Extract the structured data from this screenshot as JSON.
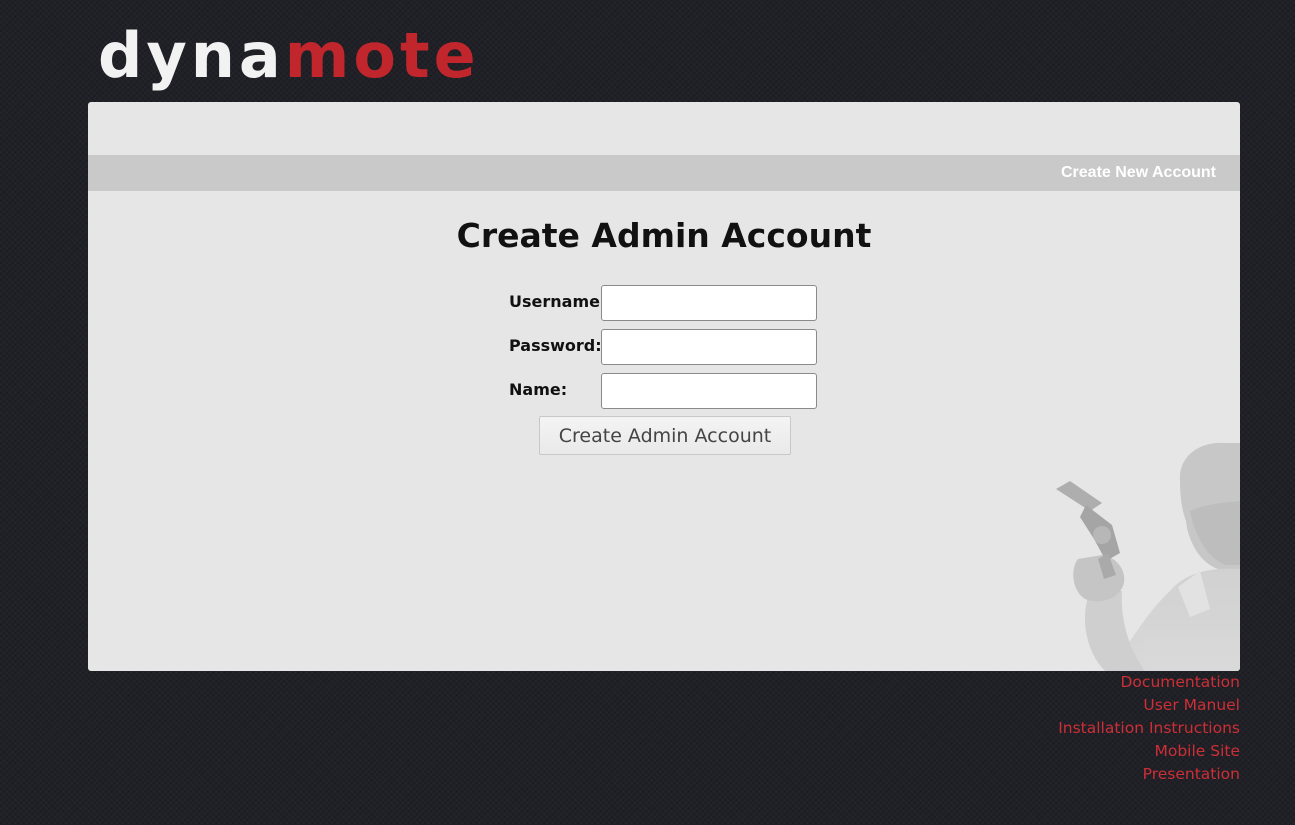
{
  "logo": {
    "part_light": "dyna",
    "part_accent": "mote"
  },
  "nav": {
    "create_account": "Create New Account"
  },
  "form": {
    "title": "Create Admin Account",
    "fields": {
      "username": {
        "label": "Username:",
        "value": ""
      },
      "password": {
        "label": "Password:",
        "value": ""
      },
      "name": {
        "label": "Name:",
        "value": ""
      }
    },
    "submit": "Create Admin Account"
  },
  "footer": {
    "links": [
      "Documentation",
      "User Manuel",
      "Installation Instructions",
      "Mobile Site",
      "Presentation"
    ]
  },
  "colors": {
    "background": "#202027",
    "panel": "#e6e6e6",
    "nav_bar": "#c9c9c9",
    "accent": "#c0262c",
    "link": "#cc2f35"
  },
  "decor": {
    "figure_icon": "gunman-silhouette-icon"
  }
}
